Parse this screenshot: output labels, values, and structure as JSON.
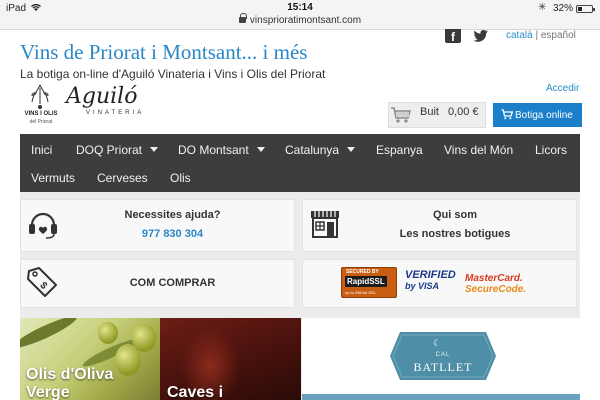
{
  "status_bar": {
    "device": "iPad",
    "time": "15:14",
    "url": "vinsprioratimontsant.com",
    "battery": "32%",
    "battery_level": 0.32
  },
  "header": {
    "title": "Vins de Priorat i Montsant... i més",
    "tagline": "La botiga on-line d'Aguiló Vinateria i Vins i Olis del Priorat",
    "lang_ca": "català",
    "lang_sep": "|",
    "lang_es": "español",
    "login": "Accedir",
    "logo_text": "VINS I OLIS",
    "logo_subtext": "del Priorat",
    "brand": "Aguiló",
    "brand_sub": "VINATERIA"
  },
  "cart": {
    "status": "Buit",
    "amount": "0,00 €",
    "shop_button": "Botiga online"
  },
  "nav": {
    "items": [
      {
        "label": "Inici",
        "dropdown": false
      },
      {
        "label": "DOQ Priorat",
        "dropdown": true
      },
      {
        "label": "DO Montsant",
        "dropdown": true
      },
      {
        "label": "Catalunya",
        "dropdown": true
      },
      {
        "label": "Espanya",
        "dropdown": false
      },
      {
        "label": "Vins del Món",
        "dropdown": false
      },
      {
        "label": "Licors",
        "dropdown": false
      },
      {
        "label": "Vermuts",
        "dropdown": false
      },
      {
        "label": "Cerveses",
        "dropdown": false
      },
      {
        "label": "Olis",
        "dropdown": false
      }
    ]
  },
  "cards": {
    "help_title": "Necessites ajuda?",
    "help_phone": "977 830 304",
    "shops_line1": "Qui som",
    "shops_line2": "Les nostres botigues",
    "buy_title": "COM COMPRAR",
    "ssl_secured": "SECURED BY",
    "ssl_brand": "RapidSSL",
    "ssl_note": "up to 256-bit SSL",
    "visa_line1": "VERIFIED",
    "visa_line2": "by VISA",
    "mc_line1": "MasterCard.",
    "mc_line2": "SecureCode."
  },
  "banners": {
    "olive_label": "Olis d'Oliva Verge",
    "cave_label": "Caves i",
    "badge_small": "CAL",
    "badge_name": "BATLLET"
  },
  "colors": {
    "accent": "#2a88c6",
    "nav_bg": "#3d3d3d",
    "button": "#1b80c9"
  }
}
